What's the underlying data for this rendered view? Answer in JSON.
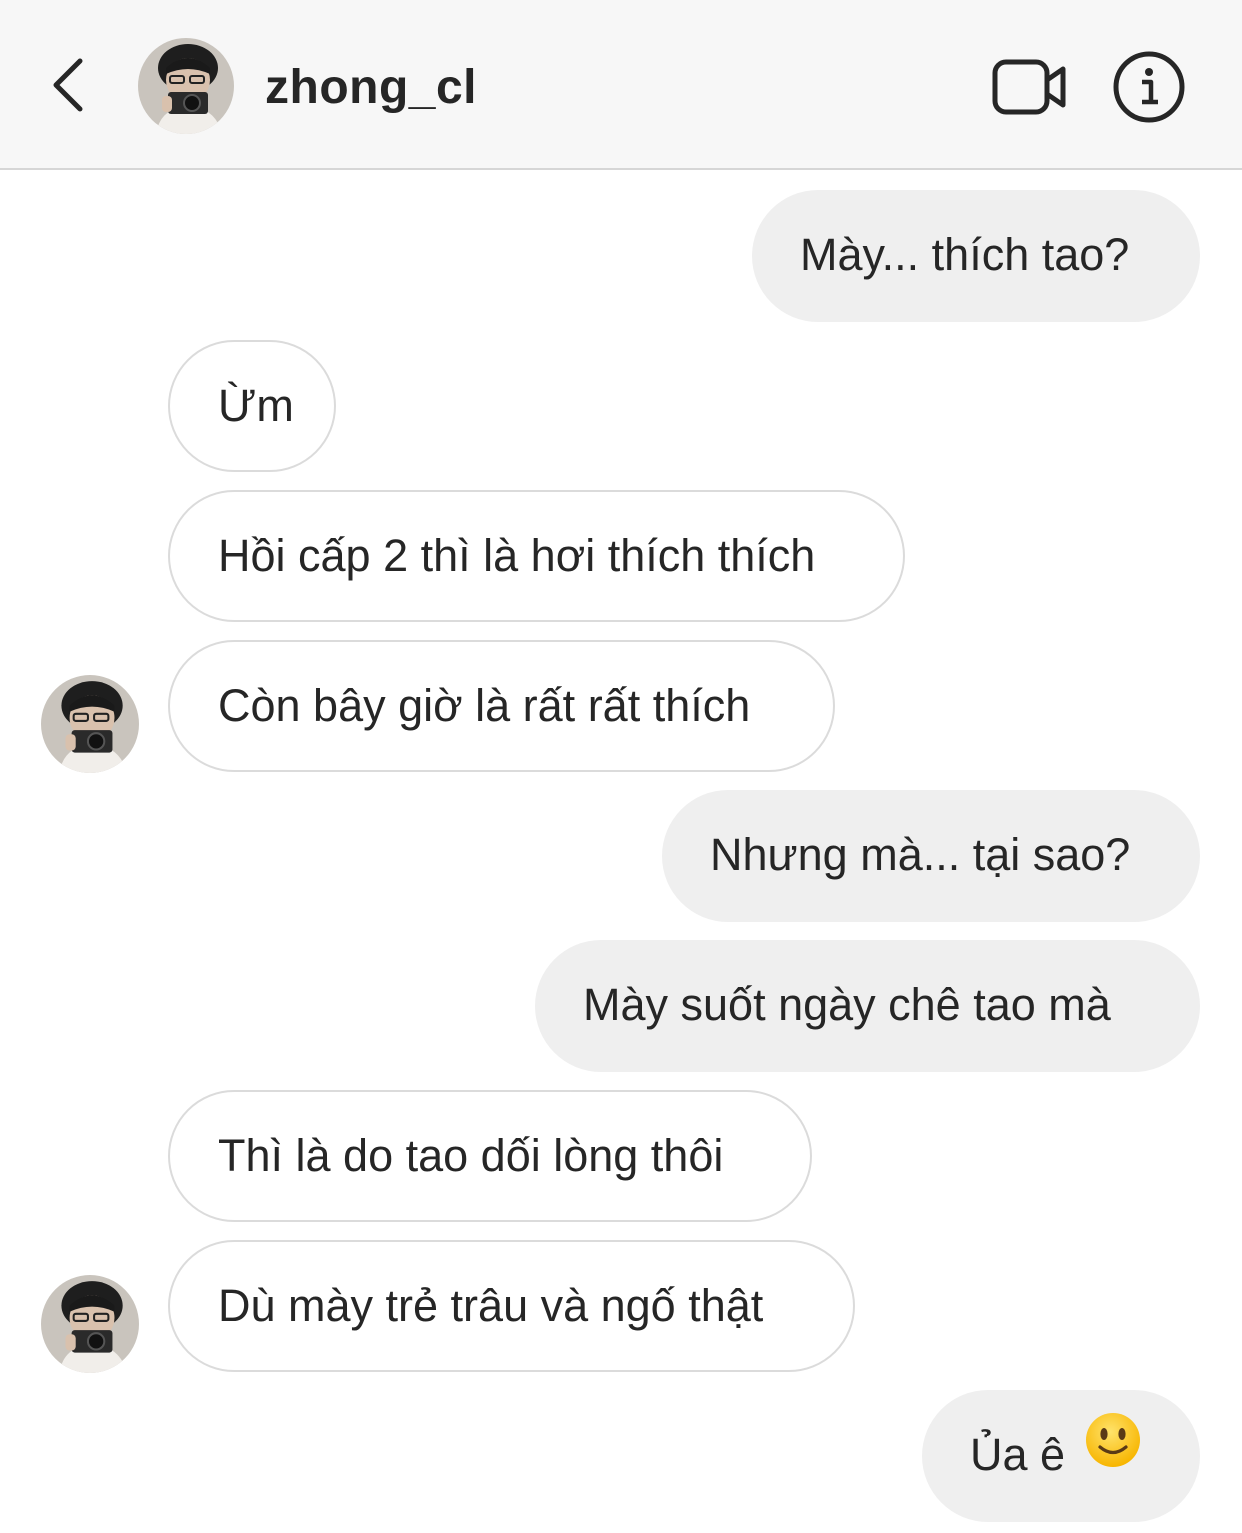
{
  "header": {
    "username": "zhong_cl",
    "back_icon": "chevron-left-icon",
    "video_icon": "video-camera-icon",
    "info_icon": "info-icon"
  },
  "messages": [
    {
      "side": "sent",
      "text": "Mày... thích tao?"
    },
    {
      "side": "received",
      "text": "Ừm"
    },
    {
      "side": "received",
      "text": "Hồi cấp 2 thì là hơi thích thích"
    },
    {
      "side": "received",
      "text": "Còn bây giờ là rất rất thích"
    },
    {
      "side": "sent",
      "text": "Nhưng mà... tại sao?"
    },
    {
      "side": "sent",
      "text": "Mày suốt ngày chê tao mà"
    },
    {
      "side": "received",
      "text": "Thì là do tao dối lòng thôi"
    },
    {
      "side": "received",
      "text": "Dù mày trẻ trâu và ngố thật"
    },
    {
      "side": "sent",
      "text": "Ủa ê",
      "emoji": "slightly-smiling-face-icon"
    }
  ],
  "colors": {
    "header_bg": "#f7f7f7",
    "sent_bubble": "#efefef",
    "received_border": "#dbdbdb",
    "text": "#262626"
  }
}
